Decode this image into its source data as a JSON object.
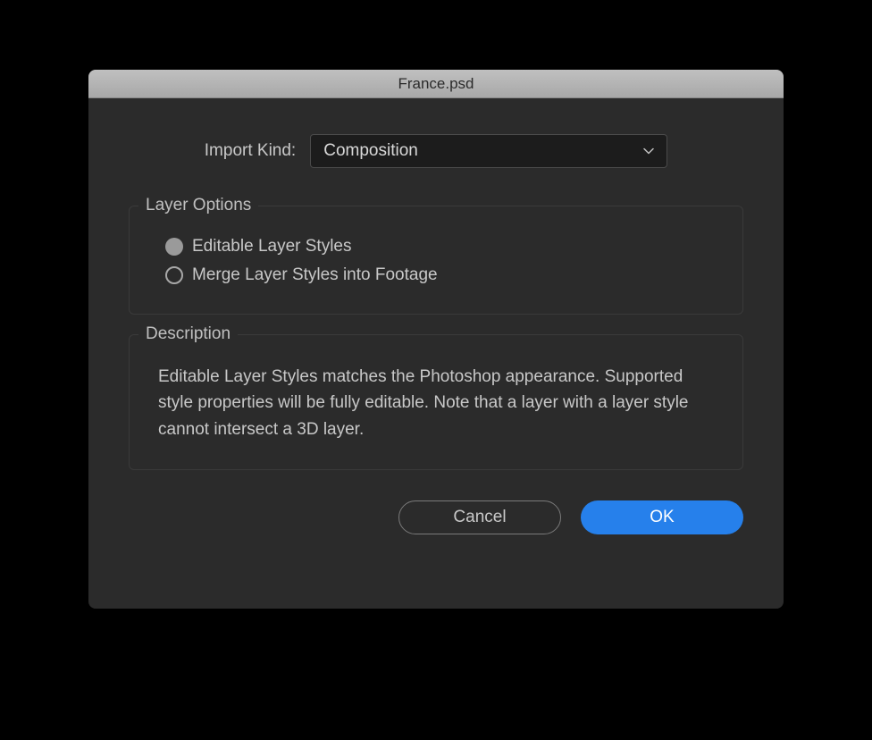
{
  "dialog": {
    "title": "France.psd",
    "importKind": {
      "label": "Import Kind:",
      "selected": "Composition"
    },
    "layerOptions": {
      "legend": "Layer Options",
      "options": [
        {
          "label": "Editable Layer Styles",
          "selected": true
        },
        {
          "label": "Merge Layer Styles into Footage",
          "selected": false
        }
      ]
    },
    "description": {
      "legend": "Description",
      "text": "Editable Layer Styles matches the Photoshop appearance. Supported style properties will be fully editable. Note that a layer with a layer style cannot intersect a 3D layer."
    },
    "buttons": {
      "cancel": "Cancel",
      "ok": "OK"
    }
  }
}
